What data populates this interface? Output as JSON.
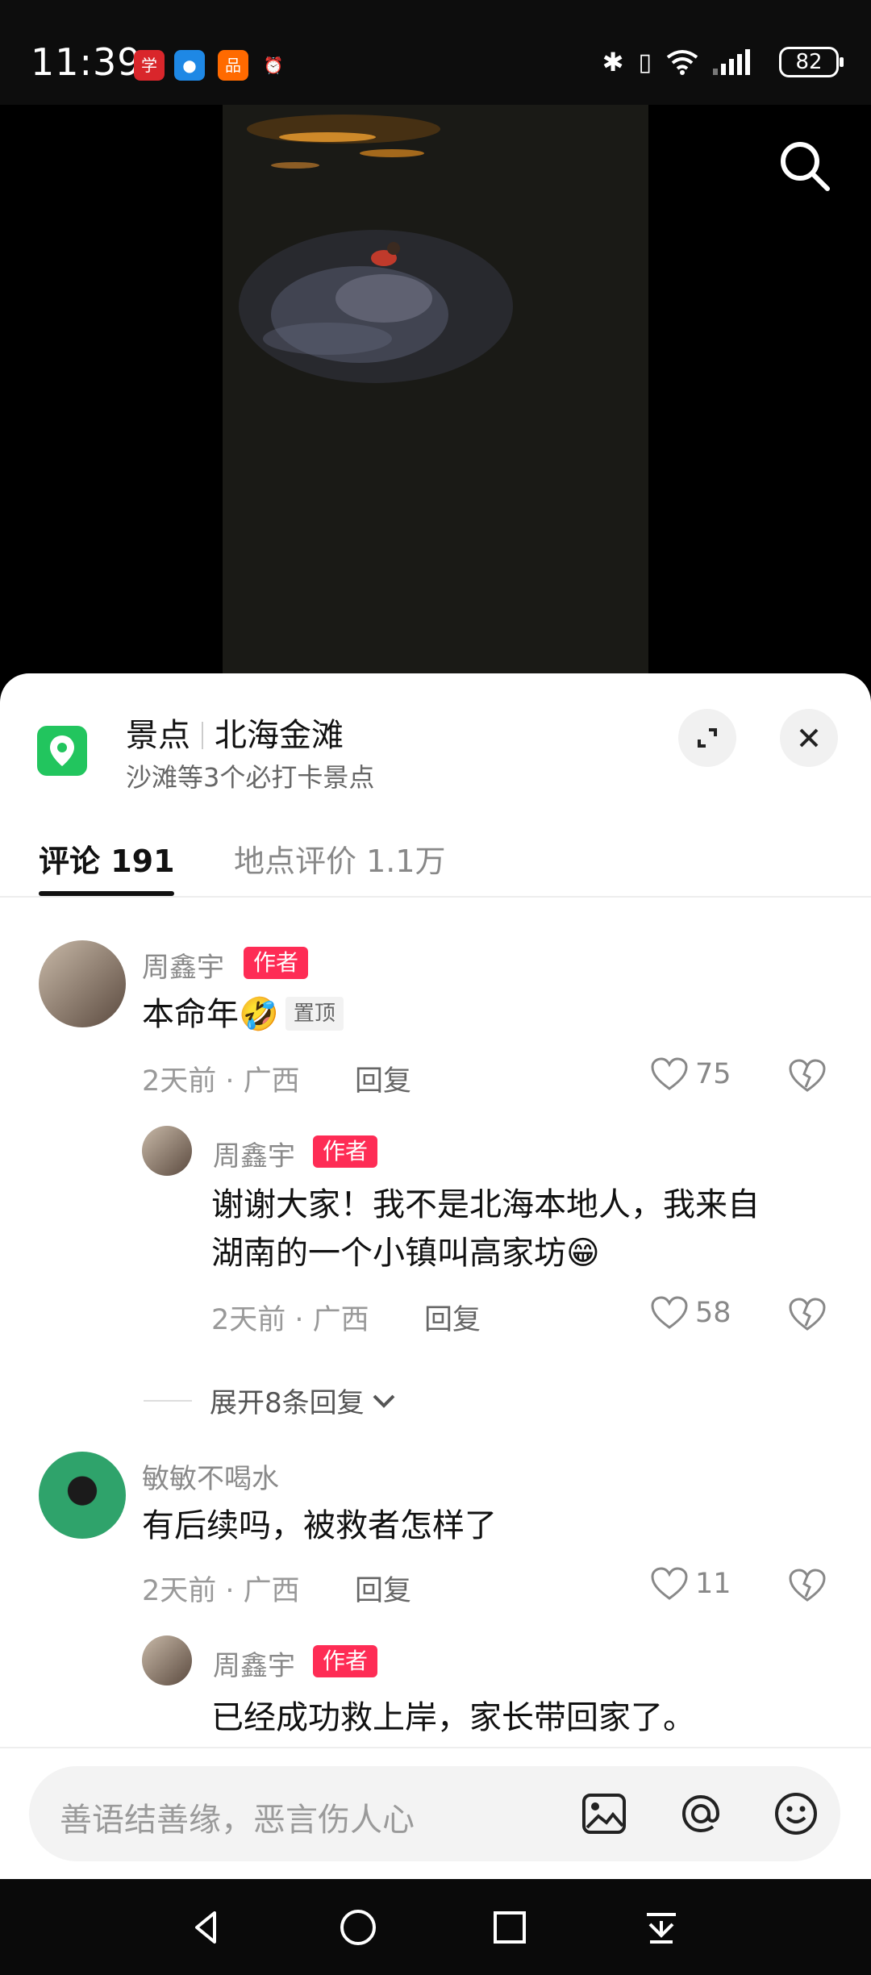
{
  "status_bar": {
    "time": "11:39",
    "battery": "82"
  },
  "location": {
    "category": "景点",
    "name": "北海金滩",
    "subtitle": "沙滩等3个必打卡景点"
  },
  "tabs": [
    {
      "label": "评论 191"
    },
    {
      "label": "地点评价 1.1万"
    }
  ],
  "comments": [
    {
      "username": "周鑫宇",
      "badge": "作者",
      "text": "本命年🤣",
      "pinned": "置顶",
      "time": "2天前",
      "location": "广西",
      "reply": "回复",
      "likes": "75",
      "replies": [
        {
          "username": "周鑫宇",
          "badge": "作者",
          "text_line1": "谢谢大家！我不是北海本地人，我来自",
          "text_line2": "湖南的一个小镇叫高家坊😁",
          "time": "2天前",
          "location": "广西",
          "reply": "回复",
          "likes": "58"
        }
      ],
      "expand_label": "展开8条回复"
    },
    {
      "username": "敏敏不喝水",
      "text": "有后续吗，被救者怎样了",
      "time": "2天前",
      "location": "广西",
      "reply": "回复",
      "likes": "11",
      "replies": [
        {
          "username": "周鑫宇",
          "badge": "作者",
          "text": "已经成功救上岸，家长带回家了。"
        }
      ]
    }
  ],
  "input": {
    "placeholder": "善语结善缘，恶言伤人心"
  },
  "colors": {
    "badge": "#fe2c55",
    "place_icon": "#22c55e",
    "sheet_bg": "#ffffff"
  },
  "icons": [
    "search-icon",
    "location-pin-icon",
    "expand-icon",
    "close-icon",
    "heart-icon",
    "dislike-heart-icon",
    "chevron-down-icon",
    "image-icon",
    "at-icon",
    "emoji-icon",
    "back-nav-icon",
    "home-nav-icon",
    "recents-nav-icon",
    "download-nav-icon"
  ]
}
